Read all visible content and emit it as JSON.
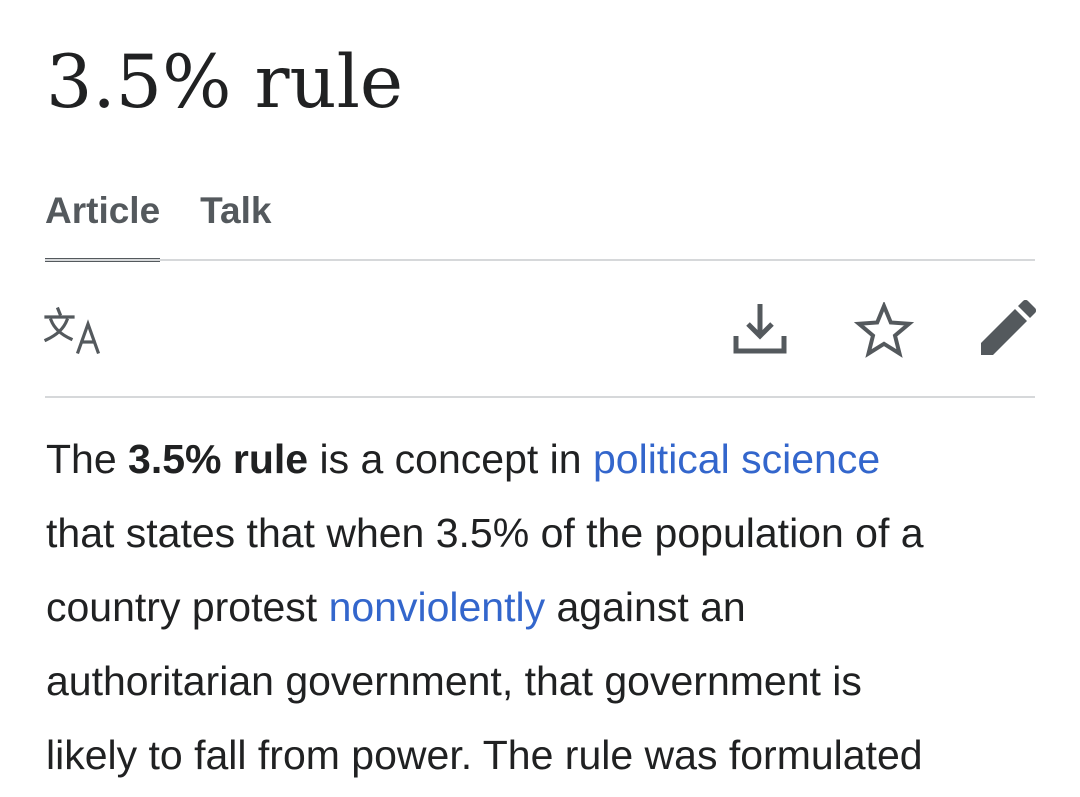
{
  "page": {
    "title": "3.5% rule"
  },
  "tabs": [
    {
      "label": "Article",
      "active": true
    },
    {
      "label": "Talk",
      "active": false
    }
  ],
  "toolbar": {
    "icons": [
      "language-icon",
      "download-icon",
      "star-icon",
      "edit-icon"
    ],
    "icon_color": "#54595d"
  },
  "colors": {
    "link": "#3366cc",
    "text": "#202122",
    "divider": "#d6d8da"
  },
  "article": {
    "line1": {
      "t1": "The ",
      "bold": "3.5% rule",
      "t2": " is a concept in ",
      "link": "political science"
    },
    "line2": "that states that when 3.5% of the population of a",
    "line3": {
      "t1": "country protest ",
      "link": "nonviolently",
      "t2": " against an"
    },
    "line4": "authoritarian government, that government is",
    "line5": "likely to fall from power. The rule was formulated"
  }
}
